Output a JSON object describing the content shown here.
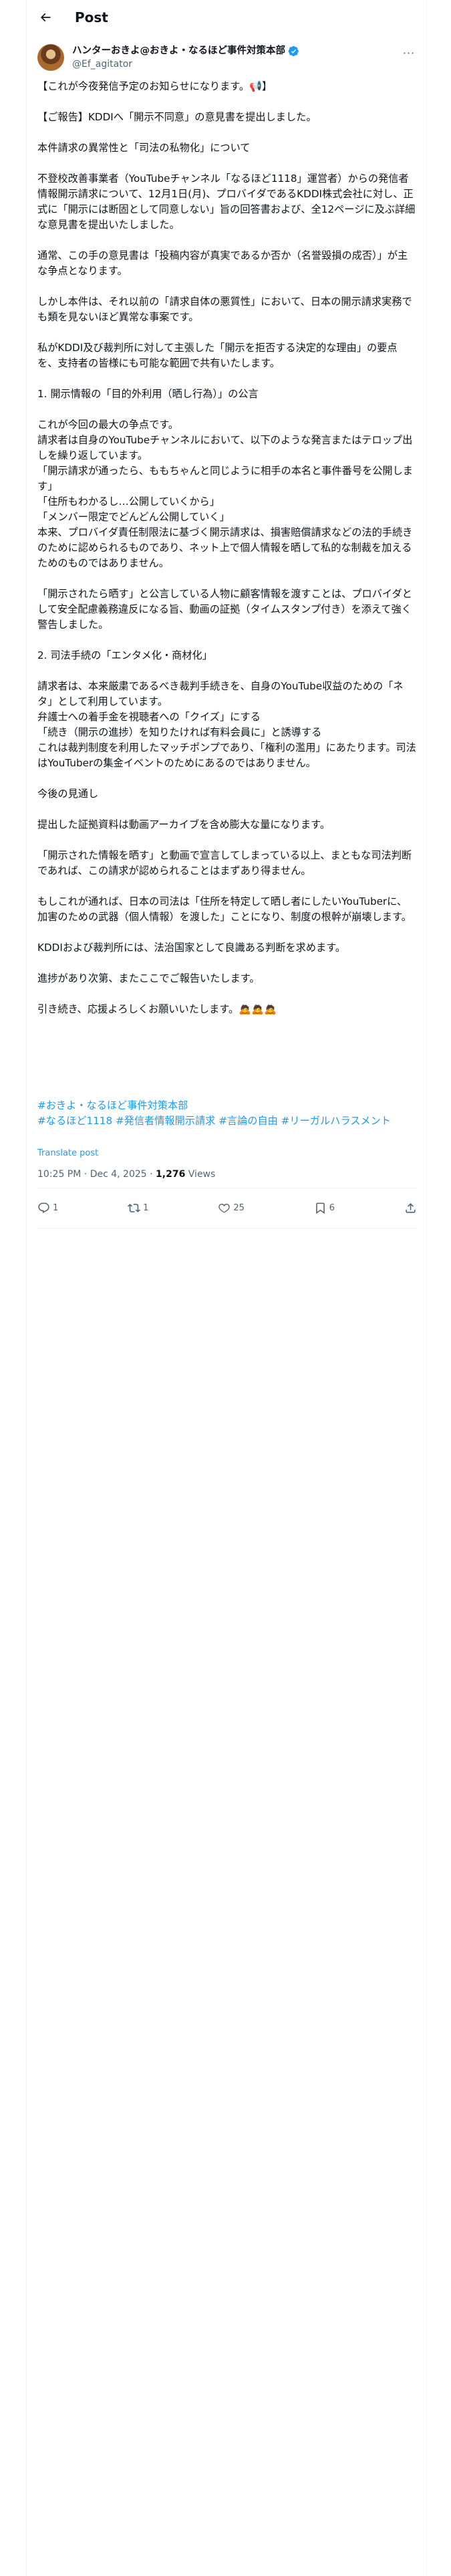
{
  "header": {
    "title": "Post"
  },
  "author": {
    "display_name": "ハンターおきよ@おきよ・なるほど事件対策本部",
    "handle": "@Ef_agitator"
  },
  "body_lines": [
    "【これが今夜発信予定のお知らせになります。📢】",
    "",
    "【ご報告】KDDIへ「開示不同意」の意見書を提出しました。",
    "",
    "本件請求の異常性と「司法の私物化」について",
    "",
    "不登校改善事業者（YouTubeチャンネル「なるほど1118」運営者）からの発信者情報開示請求について、12月1日(月)、プロバイダであるKDDI株式会社に対し、正式に「開示には断固として同意しない」旨の回答書および、全12ページに及ぶ詳細な意見書を提出いたしました。",
    "",
    "通常、この手の意見書は「投稿内容が真実であるか否か（名誉毀損の成否）」が主な争点となります。",
    "",
    "しかし本件は、それ以前の「請求自体の悪質性」において、日本の開示請求実務でも類を見ないほど異常な事案です。",
    "",
    "私がKDDI及び裁判所に対して主張した「開示を拒否する決定的な理由」の要点を、支持者の皆様にも可能な範囲で共有いたします。",
    "",
    "1. 開示情報の「目的外利用（晒し行為）」の公言",
    "",
    "これが今回の最大の争点です。",
    "請求者は自身のYouTubeチャンネルにおいて、以下のような発言またはテロップ出しを繰り返しています。",
    "「開示請求が通ったら、ももちゃんと同じように相手の本名と事件番号を公開します」",
    "「住所もわかるし…公開していくから」",
    "「メンバー限定でどんどん公開していく」",
    "本来、プロバイダ責任制限法に基づく開示請求は、損害賠償請求などの法的手続きのために認められるものであり、ネット上で個人情報を晒して私的な制裁を加えるためのものではありません。",
    "",
    "「開示されたら晒す」と公言している人物に顧客情報を渡すことは、プロバイダとして安全配慮義務違反になる旨、動画の証拠（タイムスタンプ付き）を添えて強く警告しました。",
    "",
    "2. 司法手続の「エンタメ化・商材化」",
    "",
    "請求者は、本来厳粛であるべき裁判手続きを、自身のYouTube収益のための「ネタ」として利用しています。",
    "弁護士への着手金を視聴者への「クイズ」にする",
    "「続き（開示の進捗）を知りたければ有料会員に」と誘導する",
    "これは裁判制度を利用したマッチポンプであり、「権利の濫用」にあたります。司法はYouTuberの集金イベントのためにあるのではありません。",
    "",
    "今後の見通し",
    "",
    "提出した証拠資料は動画アーカイブを含め膨大な量になります。",
    "",
    "「開示された情報を晒す」と動画で宣言してしまっている以上、まともな司法判断であれば、この請求が認められることはまずあり得ません。",
    "",
    "もしこれが通れば、日本の司法は「住所を特定して晒し者にしたいYouTuberに、加害のための武器（個人情報）を渡した」ことになり、制度の根幹が崩壊します。",
    "",
    "KDDIおよび裁判所には、法治国家として良識ある判断を求めます。",
    "",
    "進捗があり次第、またここでご報告いたします。",
    "",
    "引き続き、応援よろしくお願いいたします。🙇🙇🙇"
  ],
  "hashtags": {
    "line1": "#おきよ・なるほど事件対策本部",
    "line2": "#なるほど1118 #発信者情報開示請求 #言論の自由 #リーガルハラスメント"
  },
  "translate_label": "Translate post",
  "meta": {
    "time": "10:25 PM",
    "date": "Dec 4, 2025",
    "views_count": "1,276",
    "views_label": "Views"
  },
  "actions": {
    "reply_count": "1",
    "repost_count": "1",
    "like_count": "25",
    "bookmark_count": "6"
  },
  "colors": {
    "accent": "#1d9bf0",
    "secondary_text": "#536471",
    "primary_text": "#0f1419",
    "border": "#eff3f4"
  },
  "icons": [
    "back-arrow-icon",
    "verified-badge-icon",
    "more-icon",
    "reply-icon",
    "repost-icon",
    "like-icon",
    "bookmark-icon",
    "share-icon"
  ]
}
